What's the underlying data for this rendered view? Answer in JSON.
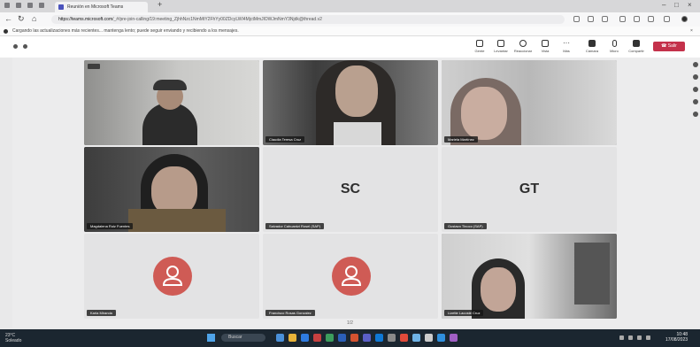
{
  "browser": {
    "tab_title": "Reunión en Microsoft Teams",
    "url_host": "https://teams.microsoft.com",
    "url_rest": "/_#/pre-join-calling/19:meeting_ZjhhNzc1NmMtY2FhYy00ZDcyLWI4MjctMmJlOWJmNmY3Njdk@thread.v2"
  },
  "infobar": {
    "text": "Cargando las actualizaciones más recientes... mantenga lento; puede seguir enviando y recibiendo a los mensajes."
  },
  "toolbar": {
    "people": "Gente",
    "raise": "Levantar",
    "react": "Reaccionar",
    "view": "Vista",
    "more": "Más",
    "camera": "Cámara",
    "mic": "Micro",
    "share": "Compartir",
    "leave": "Salir"
  },
  "participants": [
    {
      "name": "",
      "kind": "video"
    },
    {
      "name": "Claudia Teresa Cruz",
      "kind": "video"
    },
    {
      "name": "Mariela Martínez",
      "kind": "video"
    },
    {
      "name": "Magdalena Ruiz Fuentes",
      "kind": "video"
    },
    {
      "name": "Salvador Cahuantzi Rosel (SAP)",
      "kind": "initials",
      "initials": "SC"
    },
    {
      "name": "Gustavo Tinoco (SAP)",
      "kind": "initials",
      "initials": "GT"
    },
    {
      "name": "Karla Miranda",
      "kind": "avatar"
    },
    {
      "name": "Francisco Rosas Gonzalez",
      "kind": "avatar"
    },
    {
      "name": "Lizette Lacoste Cruz",
      "kind": "video"
    }
  ],
  "pager": "1/2",
  "taskbar": {
    "weather_temp": "23°C",
    "weather_desc": "Soleado",
    "search": "Buscar",
    "time": "10:48",
    "date": "17/08/2023"
  },
  "colors": {
    "leave": "#c4314b",
    "avatar_red": "#cf5b55",
    "teams_purple": "#4b53bc",
    "taskbar": "#1b2630"
  }
}
